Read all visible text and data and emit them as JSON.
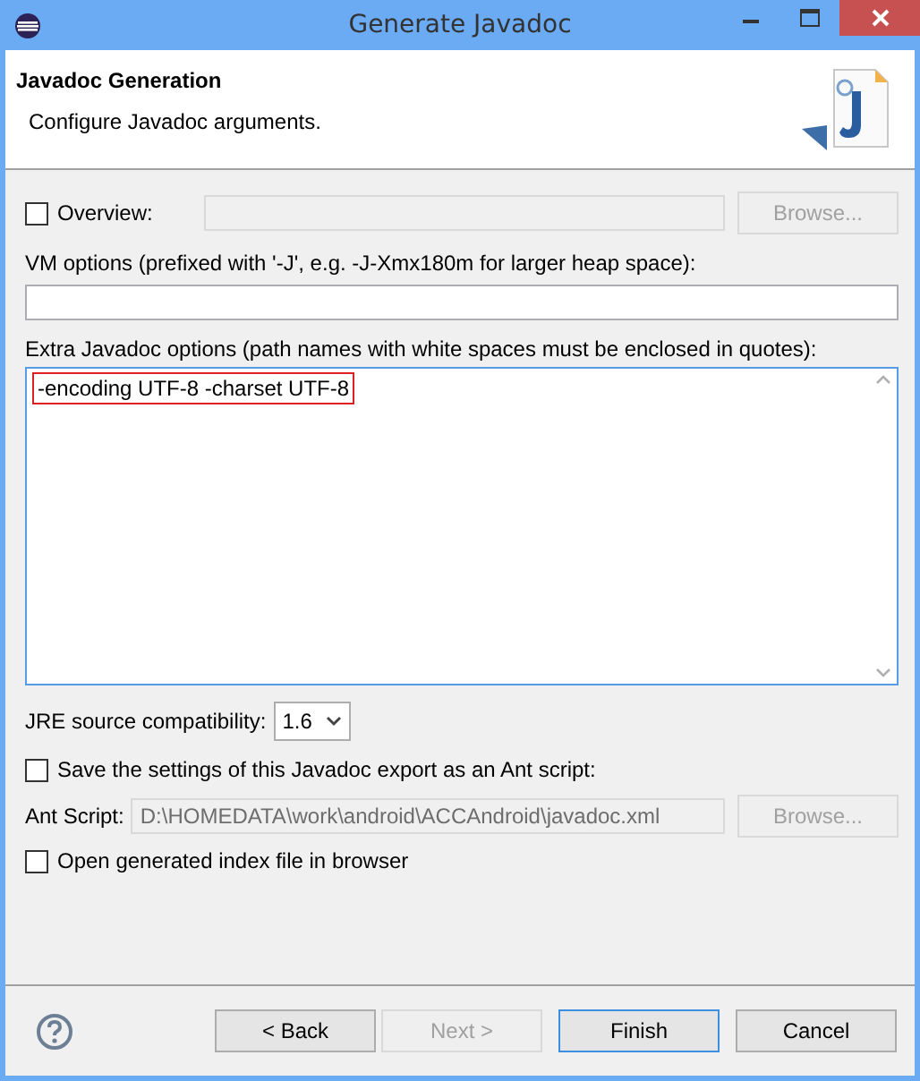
{
  "window": {
    "title": "Generate Javadoc"
  },
  "header": {
    "title": "Javadoc Generation",
    "description": "Configure Javadoc arguments."
  },
  "overview": {
    "label": "Overview:",
    "checked": false,
    "disabled": true,
    "browse": {
      "label": "Browse...",
      "disabled": true
    }
  },
  "vm_options": {
    "label": "VM options (prefixed with '-J', e.g. -J-Xmx180m for larger heap space):"
  },
  "extra_options": {
    "label": "Extra Javadoc options (path names with white spaces must be enclosed in quotes):",
    "value": "-encoding UTF-8 -charset UTF-8",
    "highlighted": true
  },
  "jre": {
    "label": "JRE source compatibility:",
    "value": "1.6"
  },
  "save_ant": {
    "label": "Save the settings of this Javadoc export as an Ant script:",
    "checked": false
  },
  "ant_script": {
    "label": "Ant Script:",
    "value": "D:\\HOMEDATA\\work\\android\\ACCAndroid\\javadoc.xml",
    "disabled": true,
    "browse": {
      "label": "Browse...",
      "disabled": true
    }
  },
  "open_index": {
    "label": "Open generated index file in browser",
    "checked": false
  },
  "buttons": [
    {
      "label": "< Back",
      "disabled": false,
      "default": false
    },
    {
      "label": "Next >",
      "disabled": true,
      "default": false
    },
    {
      "label": "Finish",
      "disabled": false,
      "default": true
    },
    {
      "label": "Cancel",
      "disabled": false,
      "default": false
    }
  ]
}
